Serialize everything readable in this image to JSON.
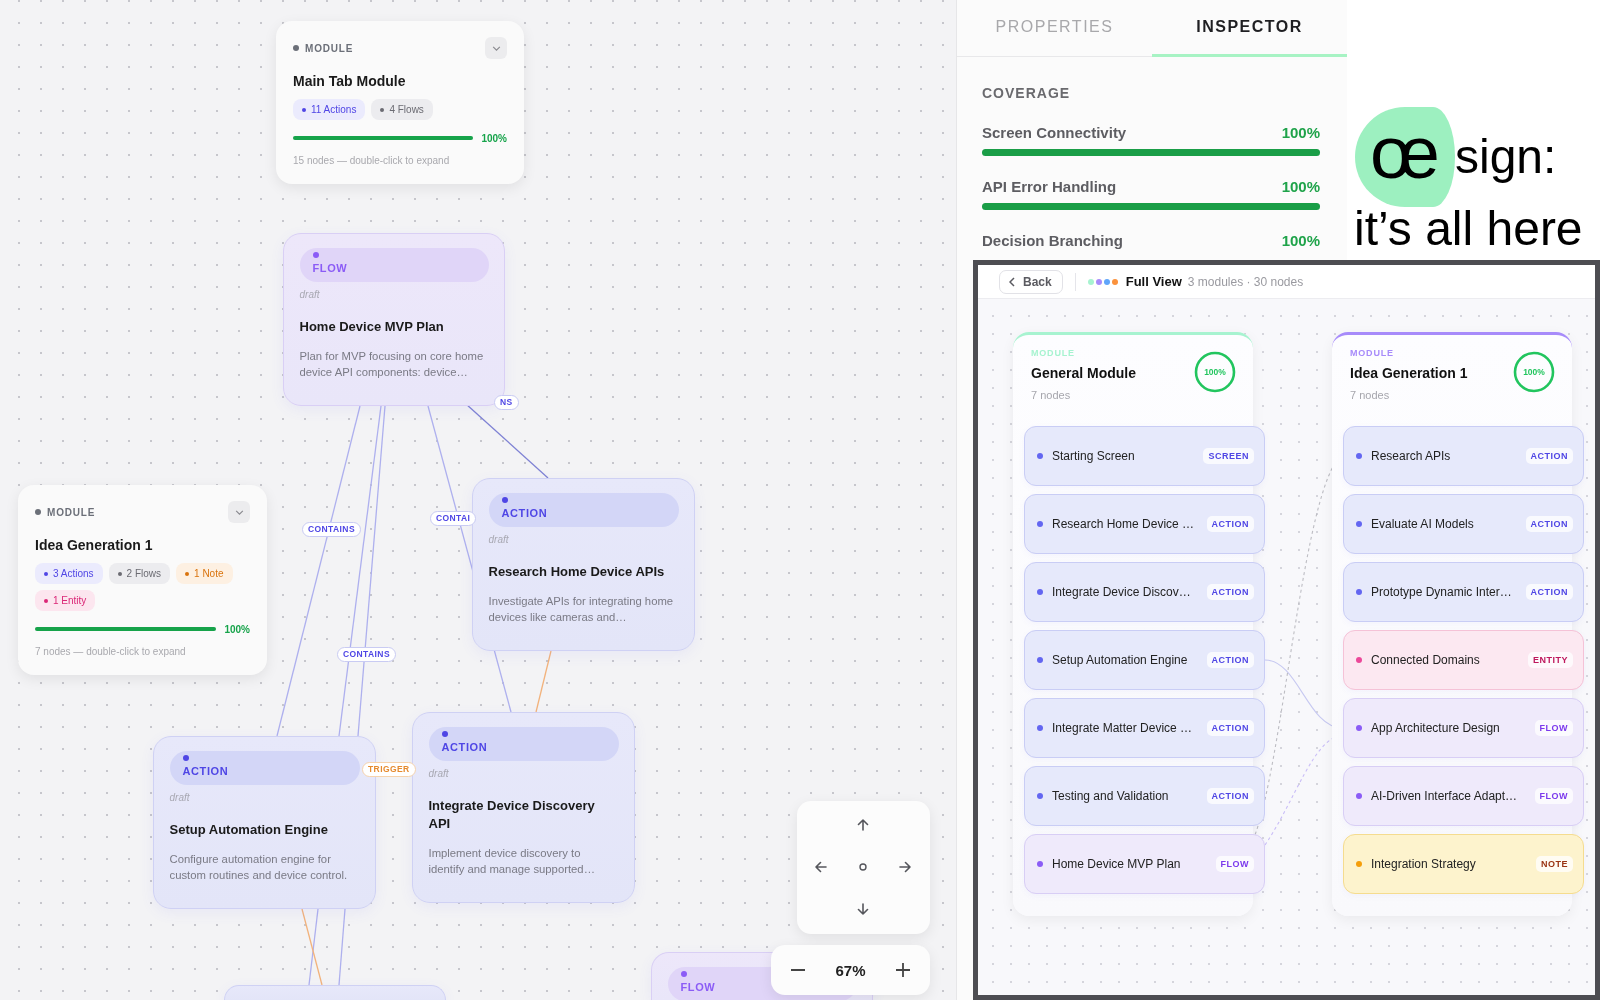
{
  "canvas": {
    "modules": [
      {
        "label": "MODULE",
        "title": "Main Tab Module",
        "chips": [
          {
            "kind": "action",
            "text": "11 Actions"
          },
          {
            "kind": "flow",
            "text": "4 Flows"
          }
        ],
        "level": 1,
        "percent": "100%",
        "footer": "15 nodes — double-click to expand"
      },
      {
        "label": "MODULE",
        "title": "Idea Generation 1",
        "chips": [
          {
            "kind": "action",
            "text": "3 Actions"
          },
          {
            "kind": "flow",
            "text": "2 Flows"
          },
          {
            "kind": "note",
            "text": "1 Note"
          },
          {
            "kind": "entity",
            "text": "1 Entity"
          }
        ],
        "level": 1,
        "percent": "100%",
        "footer": "7 nodes — double-click to expand"
      }
    ],
    "nodes": [
      {
        "kind": "flow",
        "label": "FLOW",
        "status": "draft",
        "title": "Home Device MVP Plan",
        "description": "Plan for MVP focusing on core home device API components: device…"
      },
      {
        "kind": "action",
        "label": "ACTION",
        "status": "draft",
        "title": "Research Home Device APIs",
        "description": "Investigate APIs for integrating home devices like cameras and…"
      },
      {
        "kind": "action",
        "label": "ACTION",
        "status": "draft",
        "title": "Setup Automation Engine",
        "description": "Configure automation engine for custom routines and device control."
      },
      {
        "kind": "action",
        "label": "ACTION",
        "status": "draft",
        "title": "Integrate Device Discovery API",
        "description": "Implement device discovery to identify and manage supported…"
      },
      {
        "kind": "action"
      },
      {
        "kind": "flow",
        "label": "FLOW"
      }
    ],
    "edge_labels": [
      {
        "kind": "contains",
        "text": "NS"
      },
      {
        "kind": "contains",
        "text": "CONTAINS"
      },
      {
        "kind": "contains",
        "text": "CONTAI"
      },
      {
        "kind": "contains",
        "text": "CONTAINS"
      },
      {
        "kind": "triggers",
        "text": "TRIGGER"
      }
    ],
    "zoom": {
      "value": "67%"
    }
  },
  "panel": {
    "tabs": [
      {
        "label": "PROPERTIES",
        "selected": false
      },
      {
        "label": "INSPECTOR",
        "selected": true
      }
    ],
    "section": "COVERAGE",
    "metrics": [
      {
        "name": "Screen Connectivity",
        "value": "100%",
        "level": 1
      },
      {
        "name": "API Error Handling",
        "value": "100%",
        "level": 1
      },
      {
        "name": "Decision Branching",
        "value": "100%"
      }
    ]
  },
  "brand": {
    "mark": "œ",
    "word": "sign:",
    "tagline": "it’s all here"
  },
  "full_view": {
    "back": "Back",
    "dots": [
      {
        "color": "#a7f3d0"
      },
      {
        "color": "#a78bfa"
      },
      {
        "color": "#60a5fa"
      },
      {
        "color": "#fb923c"
      }
    ],
    "title": "Full View",
    "summary": "3 modules · 30 nodes",
    "modules": [
      {
        "label": "MODULE",
        "color": "#a7f3d0",
        "title": "General Module",
        "count": "7 nodes",
        "level": 1,
        "percent": "100%",
        "rows": [
          {
            "kind": "screen",
            "name": "Starting Screen",
            "tag": "SCREEN"
          },
          {
            "kind": "action",
            "name": "Research Home Device …",
            "tag": "ACTION"
          },
          {
            "kind": "action",
            "name": "Integrate Device Discov…",
            "tag": "ACTION"
          },
          {
            "kind": "action",
            "name": "Setup Automation Engine",
            "tag": "ACTION"
          },
          {
            "kind": "action",
            "name": "Integrate Matter Device …",
            "tag": "ACTION"
          },
          {
            "kind": "action",
            "name": "Testing and Validation",
            "tag": "ACTION"
          },
          {
            "kind": "flow",
            "name": "Home Device MVP Plan",
            "tag": "FLOW"
          }
        ]
      },
      {
        "label": "MODULE",
        "color": "#a78bfa",
        "title": "Idea Generation 1",
        "count": "7 nodes",
        "level": 1,
        "percent": "100%",
        "rows": [
          {
            "kind": "action",
            "name": "Research APIs",
            "tag": "ACTION"
          },
          {
            "kind": "action",
            "name": "Evaluate AI Models",
            "tag": "ACTION"
          },
          {
            "kind": "action",
            "name": "Prototype Dynamic Inter…",
            "tag": "ACTION"
          },
          {
            "kind": "entity",
            "name": "Connected Domains",
            "tag": "ENTITY"
          },
          {
            "kind": "flow",
            "name": "App Architecture Design",
            "tag": "FLOW"
          },
          {
            "kind": "flow",
            "name": "AI-Driven Interface Adapt…",
            "tag": "FLOW"
          },
          {
            "kind": "note",
            "name": "Integration Strategy",
            "tag": "NOTE"
          }
        ]
      }
    ]
  }
}
